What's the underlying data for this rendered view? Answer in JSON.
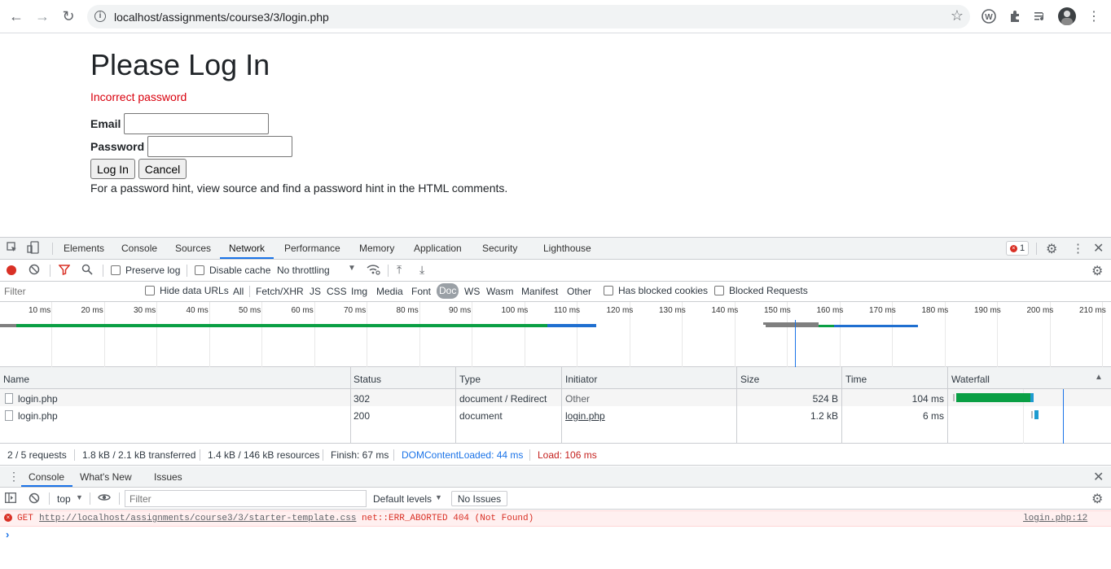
{
  "browser": {
    "url": "localhost/assignments/course3/3/login.php"
  },
  "page": {
    "title": "Please Log In",
    "error": "Incorrect password",
    "email_label": "Email",
    "password_label": "Password",
    "login_button": "Log In",
    "cancel_button": "Cancel",
    "hint": "For a password hint, view source and find a password hint in the HTML comments."
  },
  "devtools": {
    "tabs": [
      "Elements",
      "Console",
      "Sources",
      "Network",
      "Performance",
      "Memory",
      "Application",
      "Security",
      "Lighthouse"
    ],
    "active_tab": "Network",
    "error_count": "1",
    "network_toolbar": {
      "preserve_log": "Preserve log",
      "disable_cache": "Disable cache",
      "throttling": "No throttling"
    },
    "filter_bar": {
      "placeholder": "Filter",
      "hide_data_urls": "Hide data URLs",
      "types": [
        "All",
        "Fetch/XHR",
        "JS",
        "CSS",
        "Img",
        "Media",
        "Font",
        "Doc",
        "WS",
        "Wasm",
        "Manifest",
        "Other"
      ],
      "active_type": "Doc",
      "has_blocked_cookies": "Has blocked cookies",
      "blocked_requests": "Blocked Requests"
    },
    "overview": {
      "ticks": [
        "10 ms",
        "20 ms",
        "30 ms",
        "40 ms",
        "50 ms",
        "60 ms",
        "70 ms",
        "80 ms",
        "90 ms",
        "100 ms",
        "110 ms",
        "120 ms",
        "130 ms",
        "140 ms",
        "150 ms",
        "160 ms",
        "170 ms",
        "180 ms",
        "190 ms",
        "200 ms",
        "210 ms"
      ]
    },
    "table": {
      "columns": [
        "Name",
        "Status",
        "Type",
        "Initiator",
        "Size",
        "Time",
        "Waterfall"
      ],
      "rows": [
        {
          "name": "login.php",
          "status": "302",
          "type": "document / Redirect",
          "initiator": "Other",
          "size": "524 B",
          "time": "104 ms"
        },
        {
          "name": "login.php",
          "status": "200",
          "type": "document",
          "initiator": "login.php",
          "size": "1.2 kB",
          "time": "6 ms"
        }
      ]
    },
    "status_bar": {
      "requests": "2 / 5 requests",
      "transferred": "1.8 kB / 2.1 kB transferred",
      "resources": "1.4 kB / 146 kB resources",
      "finish": "Finish: 67 ms",
      "dom_content_loaded": "DOMContentLoaded: 44 ms",
      "load": "Load: 106 ms"
    },
    "console": {
      "tabs": [
        "Console",
        "What's New",
        "Issues"
      ],
      "context": "top",
      "filter_placeholder": "Filter",
      "levels": "Default levels",
      "issues": "No Issues",
      "error": {
        "method": "GET",
        "url": "http://localhost/assignments/course3/3/starter-template.css",
        "message": "net::ERR_ABORTED 404 (Not Found)",
        "source": "login.php:12"
      },
      "prompt": "›"
    },
    "colors": {
      "accent": "#1a73e8",
      "error": "#d93025",
      "dcl": "#1a73e8",
      "load": "#c5221f"
    }
  }
}
